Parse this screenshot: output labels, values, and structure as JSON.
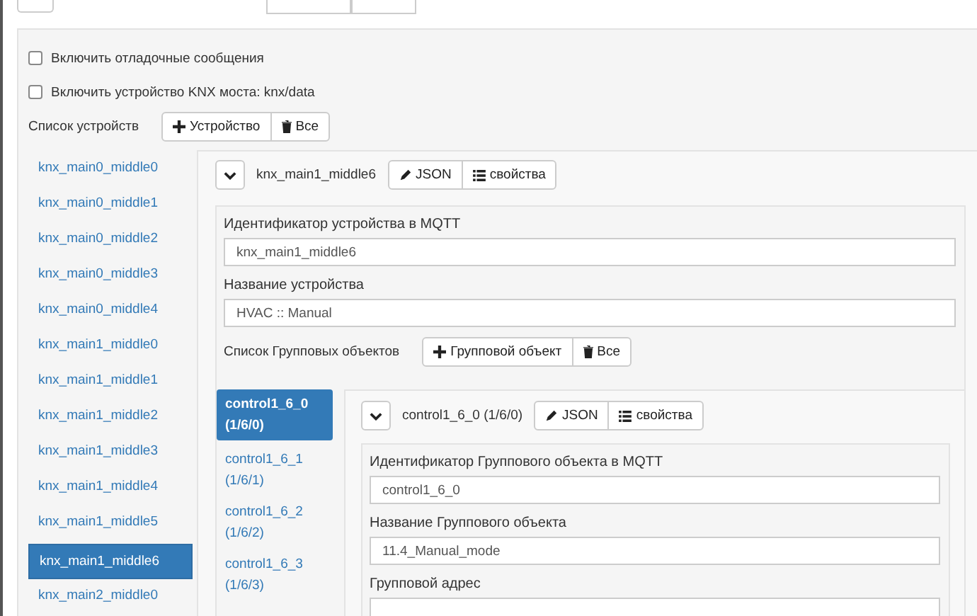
{
  "options": [
    {
      "label": "Включить отладочные сообщения",
      "checked": false
    },
    {
      "label": "Включить устройство KNX моста: knx/data",
      "checked": false
    }
  ],
  "devices": {
    "label": "Список устройств",
    "add_button": "Устройство",
    "delete_button": "Все",
    "items": [
      {
        "label": "knx_main0_middle0",
        "selected": false
      },
      {
        "label": "knx_main0_middle1",
        "selected": false
      },
      {
        "label": "knx_main0_middle2",
        "selected": false
      },
      {
        "label": "knx_main0_middle3",
        "selected": false
      },
      {
        "label": "knx_main0_middle4",
        "selected": false
      },
      {
        "label": "knx_main1_middle0",
        "selected": false
      },
      {
        "label": "knx_main1_middle1",
        "selected": false
      },
      {
        "label": "knx_main1_middle2",
        "selected": false
      },
      {
        "label": "knx_main1_middle3",
        "selected": false
      },
      {
        "label": "knx_main1_middle4",
        "selected": false
      },
      {
        "label": "knx_main1_middle5",
        "selected": false
      },
      {
        "label": "knx_main1_middle6",
        "selected": true
      },
      {
        "label": "knx_main2_middle0",
        "selected": false
      }
    ]
  },
  "device": {
    "title": "knx_main1_middle6",
    "json_button": "JSON",
    "props_button": "свойства",
    "fields": [
      {
        "label": "Идентификатор устройства в MQTT",
        "value": "knx_main1_middle6"
      },
      {
        "label": "Название устройства",
        "value": "HVAC :: Manual"
      }
    ],
    "groups_label": "Список Групповых объектов",
    "add_button": "Групповой объект",
    "delete_button": "Все",
    "groups": [
      {
        "name": "control1_6_0",
        "address": "(1/6/0)",
        "selected": true
      },
      {
        "name": "control1_6_1",
        "address": "(1/6/1)",
        "selected": false
      },
      {
        "name": "control1_6_2",
        "address": "(1/6/2)",
        "selected": false
      },
      {
        "name": "control1_6_3",
        "address": "(1/6/3)",
        "selected": false
      }
    ]
  },
  "group": {
    "title": "control1_6_0 (1/6/0)",
    "json_button": "JSON",
    "props_button": "свойства",
    "fields": [
      {
        "label": "Идентификатор Группового объекта в MQTT",
        "value": "control1_6_0"
      },
      {
        "label": "Название Группового объекта",
        "value": "11.4_Manual_mode"
      },
      {
        "label": "Групповой адрес"
      }
    ]
  }
}
